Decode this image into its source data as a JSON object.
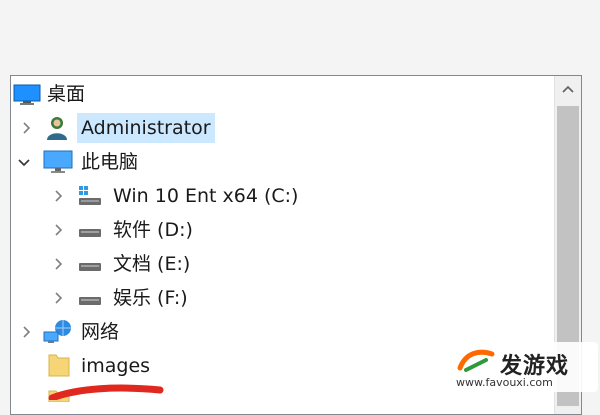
{
  "tree": {
    "items": [
      {
        "label": "桌面",
        "icon": "desktop-icon",
        "expander": "none"
      },
      {
        "label": "Administrator",
        "icon": "user-icon",
        "expander": "collapsed",
        "selected": true
      },
      {
        "label": "此电脑",
        "icon": "computer-icon",
        "expander": "expanded"
      },
      {
        "label": "Win 10 Ent x64 (C:)",
        "icon": "system-drive-icon",
        "expander": "collapsed"
      },
      {
        "label": "软件 (D:)",
        "icon": "drive-icon",
        "expander": "collapsed"
      },
      {
        "label": "文档 (E:)",
        "icon": "drive-icon",
        "expander": "collapsed"
      },
      {
        "label": "娱乐 (F:)",
        "icon": "drive-icon",
        "expander": "collapsed"
      },
      {
        "label": "网络",
        "icon": "network-icon",
        "expander": "collapsed"
      },
      {
        "label": "images",
        "icon": "folder-icon",
        "expander": "none"
      }
    ]
  },
  "watermark": {
    "title": "发游戏",
    "url": "www.favouxi.com",
    "colors": {
      "accent": "#ff6a00",
      "secondary": "#2e9a3a"
    }
  },
  "colors": {
    "selection": "#cce8ff",
    "scroll_thumb": "#c2c2c2"
  }
}
